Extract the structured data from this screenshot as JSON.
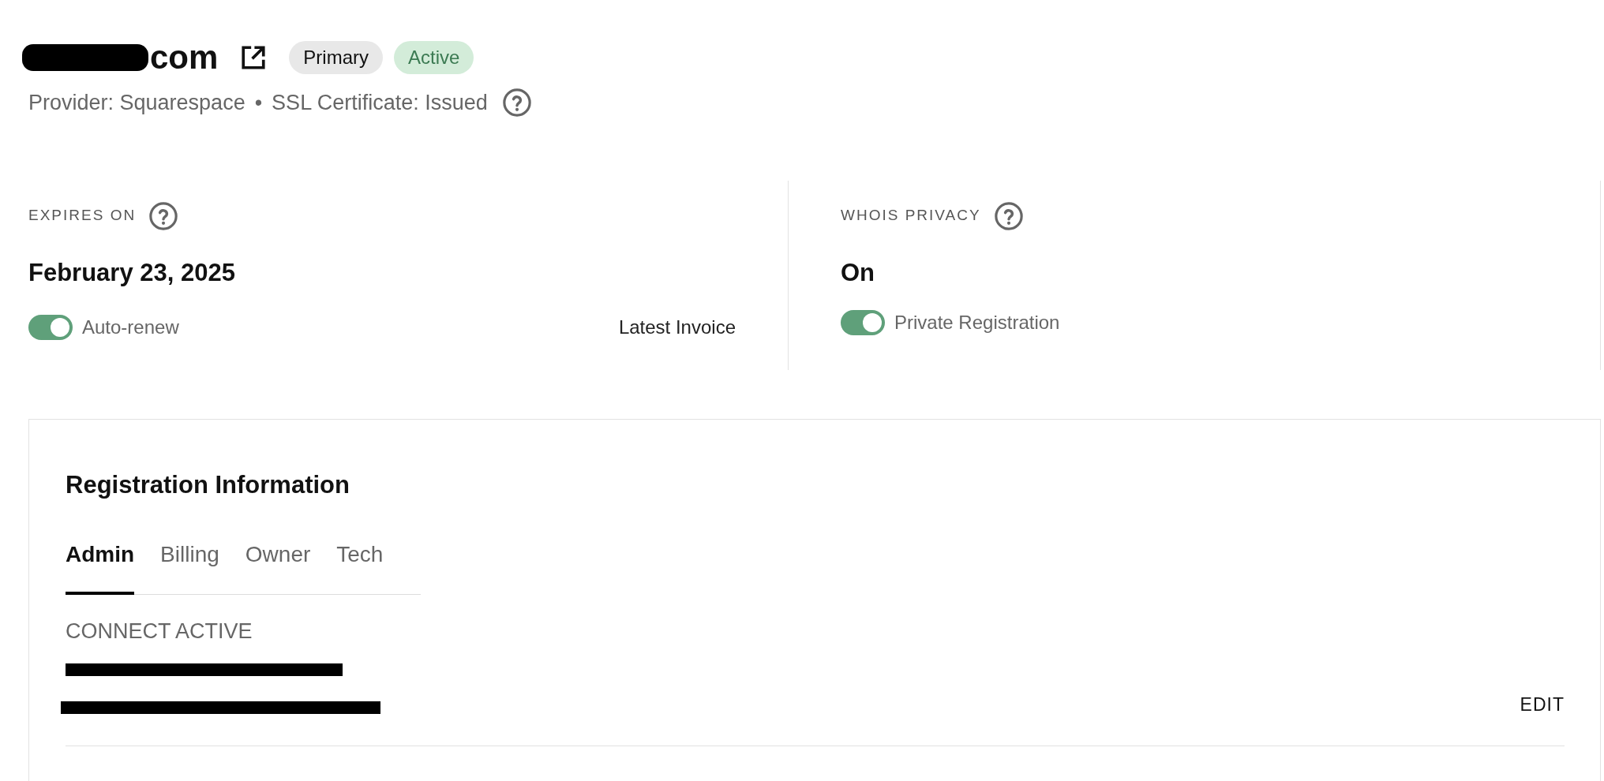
{
  "domain": {
    "name": "com",
    "badges": [
      {
        "label": "Primary",
        "kind": "neutral"
      },
      {
        "label": "Active",
        "kind": "success"
      }
    ]
  },
  "meta": {
    "provider": "Provider: Squarespace",
    "separator": "•",
    "ssl": "SSL Certificate: Issued"
  },
  "expiry": {
    "label": "EXPIRES ON",
    "value": "February 23, 2025",
    "toggle": {
      "label": "Auto-renew",
      "on": true
    },
    "link": "Latest Invoice"
  },
  "privacy": {
    "label": "WHOIS PRIVACY",
    "value": "On",
    "toggle": {
      "label": "Private Registration",
      "on": true
    }
  },
  "registration": {
    "title": "Registration Information",
    "tabs": [
      {
        "label": "Admin",
        "selected": true
      },
      {
        "label": "Billing",
        "selected": false
      },
      {
        "label": "Owner",
        "selected": false
      },
      {
        "label": "Tech",
        "selected": false
      }
    ],
    "contact": {
      "name": "CONNECT ACTIVE"
    },
    "edit": "EDIT"
  }
}
